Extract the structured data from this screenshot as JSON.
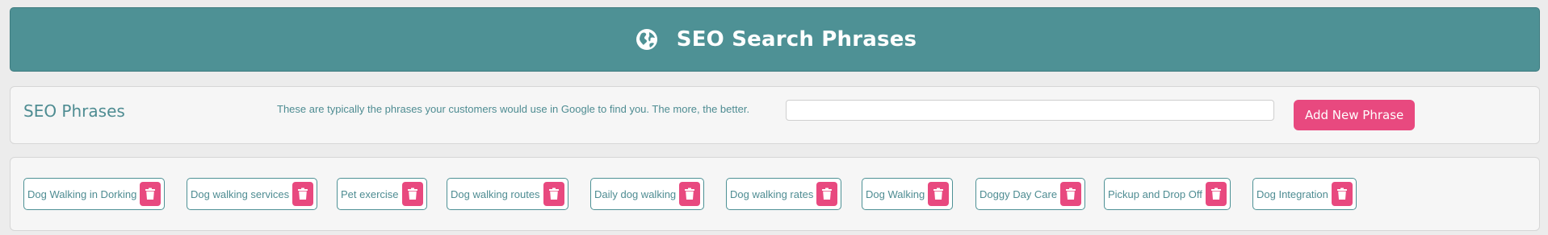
{
  "header": {
    "title": "SEO Search Phrases",
    "icon": "globe-icon",
    "background": "#4e9195"
  },
  "phrases_panel": {
    "title": "SEO Phrases",
    "description": "These are typically the phrases your customers would use in Google to find you. The more, the better.",
    "input_value": "",
    "input_placeholder": "",
    "add_button_label": "Add New Phrase",
    "accent": "#e8497f"
  },
  "phrases": [
    {
      "label": "Dog Walking in Dorking"
    },
    {
      "label": "Dog walking services"
    },
    {
      "label": "Pet exercise"
    },
    {
      "label": "Dog walking routes"
    },
    {
      "label": "Daily dog walking"
    },
    {
      "label": "Dog walking rates"
    },
    {
      "label": "Dog Walking"
    },
    {
      "label": "Doggy Day Care"
    },
    {
      "label": "Pickup and Drop Off"
    },
    {
      "label": "Dog Integration"
    }
  ],
  "delete_icon": "trash-icon"
}
